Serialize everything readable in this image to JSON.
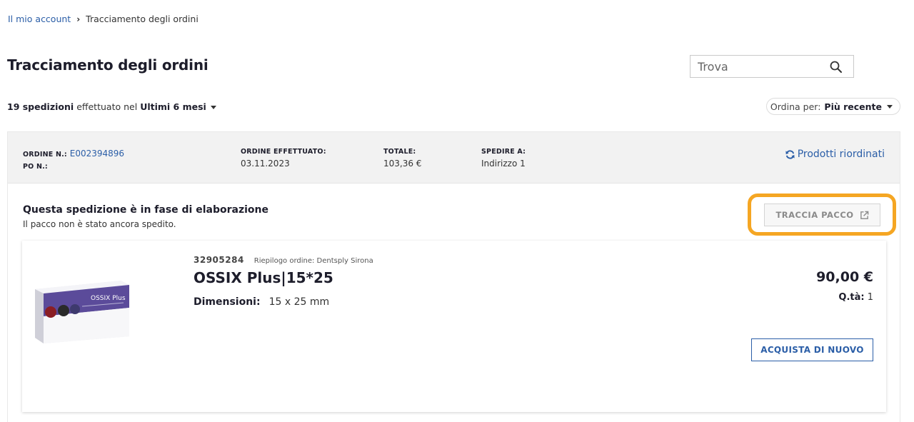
{
  "breadcrumb": {
    "parent": "Il mio account",
    "current": "Tracciamento degli ordini"
  },
  "page": {
    "title": "Tracciamento degli ordini"
  },
  "search": {
    "placeholder": "Trova",
    "icon": "search-icon"
  },
  "summary": {
    "count": "19 spedizioni",
    "text": "effettuato nel",
    "period": "Ultimi 6 mesi"
  },
  "sort": {
    "label": "Ordina per:",
    "value": "Più recente"
  },
  "order": {
    "order_no_label": "ORDINE N.:",
    "order_no": "E002394896",
    "po_label": "PO N.:",
    "date_label": "ORDINE EFFETTUATO:",
    "date": "03.11.2023",
    "total_label": "TOTALE:",
    "total": "103,36 €",
    "ship_label": "SPEDIRE A:",
    "ship_to": "Indirizzo 1",
    "reorder_label": "Prodotti riordinati"
  },
  "shipment": {
    "status_title": "Questa spedizione è in fase di elaborazione",
    "status_sub": "Il pacco non è stato ancora spedito.",
    "track_label": "TRACCIA PACCO"
  },
  "item": {
    "sku": "32905284",
    "supplier": "Riepilogo ordine: Dentsply Sirona",
    "name": "OSSIX Plus|15*25",
    "dim_label": "Dimensioni:",
    "dim_value": "15 x 25 mm",
    "price": "90,00 €",
    "qty_label": "Q.tà:",
    "qty": "1",
    "buy_again_label": "ACQUISTA DI NUOVO",
    "image_text": "OSSIX Plus"
  },
  "colors": {
    "link": "#2b5ea7",
    "highlight": "#f5a623",
    "header_bg": "#f2f2f2"
  }
}
